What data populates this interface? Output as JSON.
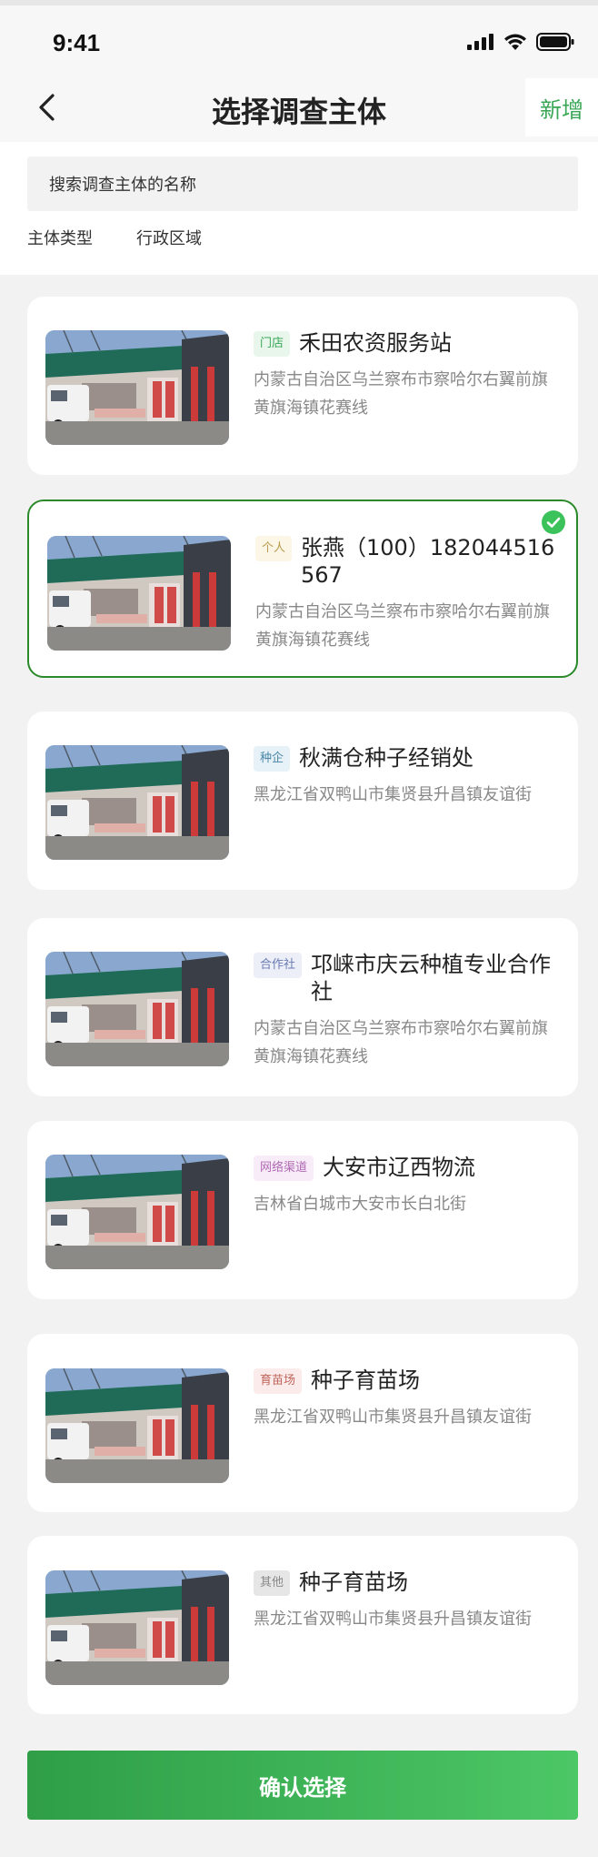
{
  "status_bar": {
    "time": "9:41"
  },
  "header": {
    "title": "选择调查主体",
    "add_label": "新增"
  },
  "search": {
    "placeholder": "搜索调查主体的名称"
  },
  "filters": [
    "主体类型",
    "行政区域"
  ],
  "cards": [
    {
      "tag": "门店",
      "name": "禾田农资服务站",
      "address": "内蒙古自治区乌兰察布市察哈尔右翼前旗黄旗海镇花赛线",
      "selected": false,
      "tag_color": "#3aa757",
      "tag_bg": "#e8f6ec"
    },
    {
      "tag": "个人",
      "name": "张燕（100）182044516567",
      "address": "内蒙古自治区乌兰察布市察哈尔右翼前旗黄旗海镇花赛线",
      "selected": true,
      "tag_color": "#b89a4a",
      "tag_bg": "#fbf6e6"
    },
    {
      "tag": "种企",
      "name": "秋满仓种子经销处",
      "address": "黑龙江省双鸭山市集贤县升昌镇友谊街",
      "selected": false,
      "tag_color": "#4a86a8",
      "tag_bg": "#e6f2f8"
    },
    {
      "tag": "合作社",
      "name": "邛崃市庆云种植专业合作社",
      "address": "内蒙古自治区乌兰察布市察哈尔右翼前旗黄旗海镇花赛线",
      "selected": false,
      "tag_color": "#6a7ab4",
      "tag_bg": "#eceff8"
    },
    {
      "tag": "网络渠道",
      "name": "大安市辽西物流",
      "address": "吉林省白城市大安市长白北街",
      "selected": false,
      "tag_color": "#b26ab4",
      "tag_bg": "#f7ecf8"
    },
    {
      "tag": "育苗场",
      "name": "种子育苗场",
      "address": "黑龙江省双鸭山市集贤县升昌镇友谊街",
      "selected": false,
      "tag_color": "#c0655a",
      "tag_bg": "#fbeceb"
    },
    {
      "tag": "其他",
      "name": "种子育苗场",
      "address": "黑龙江省双鸭山市集贤县升昌镇友谊街",
      "selected": false,
      "tag_color": "#888888",
      "tag_bg": "#e6e6e6"
    }
  ],
  "confirm_label": "确认选择"
}
